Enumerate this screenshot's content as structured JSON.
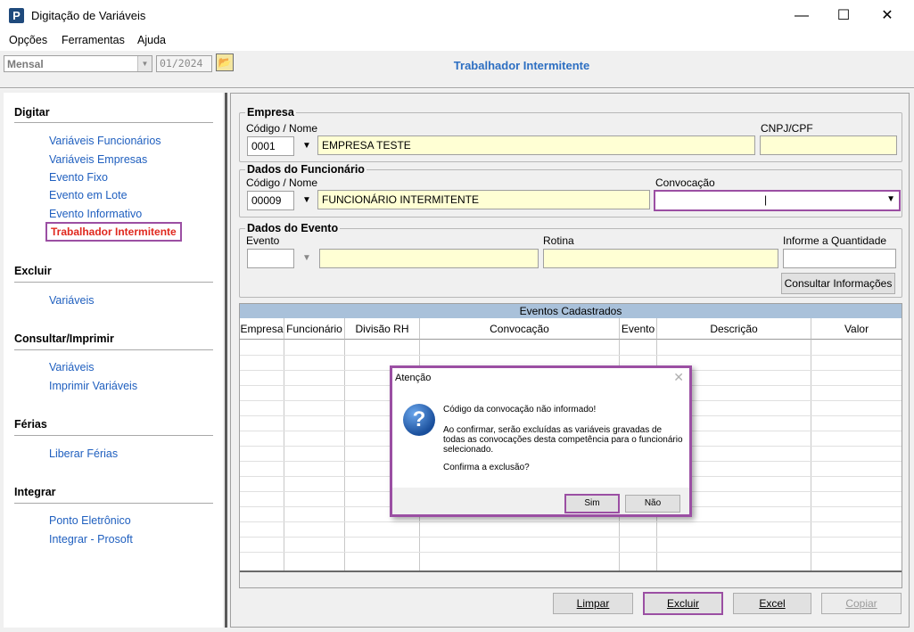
{
  "window": {
    "app_icon_letter": "P",
    "title": "Digitação de Variáveis",
    "min_symbol": "—",
    "max_symbol": "☐",
    "close_symbol": "✕"
  },
  "menu": [
    "Opções",
    "Ferramentas",
    "Ajuda"
  ],
  "toolbar": {
    "period_value": "Mensal",
    "competence": "01/2024",
    "folder_icon": "open-folder-icon"
  },
  "page_title": "Trabalhador Intermitente",
  "sidebar": {
    "sections": [
      {
        "title": "Digitar",
        "items": [
          "Variáveis Funcionários",
          "Variáveis Empresas",
          "Evento Fixo",
          "Evento em Lote",
          "Evento Informativo"
        ]
      },
      {
        "title": "Excluir",
        "items": [
          "Variáveis"
        ]
      },
      {
        "title": "Consultar/Imprimir",
        "items": [
          "Variáveis",
          "Imprimir Variáveis"
        ]
      },
      {
        "title": "Férias",
        "items": [
          "Liberar Férias"
        ]
      },
      {
        "title": "Integrar",
        "items": [
          "Ponto Eletrônico",
          "Integrar - Prosoft"
        ]
      }
    ],
    "active_item": "Trabalhador Intermitente",
    "colors": {
      "link": "#1f5fbf",
      "active": "#e0281e",
      "highlight": "#9b4fa3"
    }
  },
  "empresa": {
    "legend": "Empresa",
    "code_label": "Código / Nome",
    "code": "0001",
    "name": "EMPRESA TESTE",
    "cnpj_label": "CNPJ/CPF",
    "cnpj": ""
  },
  "funcionario": {
    "legend": "Dados do Funcionário",
    "code_label": "Código / Nome",
    "code": "00009",
    "name": "FUNCIONÁRIO INTERMITENTE",
    "convocacao_label": "Convocação",
    "convocacao": ""
  },
  "evento": {
    "legend": "Dados do Evento",
    "evento_label": "Evento",
    "rotina_label": "Rotina",
    "quantidade_label": "Informe a Quantidade",
    "consultar_button": "Consultar Informações"
  },
  "grid": {
    "caption": "Eventos Cadastrados",
    "columns": [
      "Empresa",
      "Funcionário",
      "Divisão RH",
      "Convocação",
      "Evento",
      "Descrição",
      "Valor"
    ]
  },
  "buttons": {
    "limpar": "Limpar",
    "excluir": "Excluir",
    "excel": "Excel",
    "copiar": "Copiar"
  },
  "dialog": {
    "title": "Atenção",
    "close": "✕",
    "line1": "Código da convocação não informado!",
    "line2": "Ao confirmar, serão excluídas as variáveis gravadas de todas as convocações desta competência para o funcionário selecionado.",
    "line3": "Confirma a exclusão?",
    "yes": "Sim",
    "no": "Não",
    "icon": "question-icon"
  }
}
